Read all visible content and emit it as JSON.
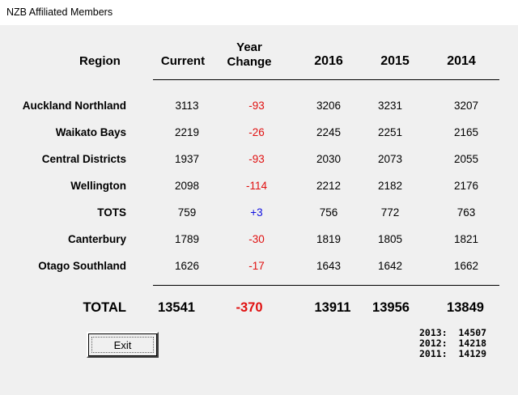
{
  "window": {
    "title": "NZB Affiliated Members"
  },
  "headers": {
    "region": "Region",
    "current": "Current",
    "year_change_line1": "Year",
    "year_change_line2": "Change",
    "y2016": "2016",
    "y2015": "2015",
    "y2014": "2014"
  },
  "rows": [
    {
      "region": "Auckland Northland",
      "current": "3113",
      "change": "-93",
      "y2016": "3206",
      "y2015": "3231",
      "y2014": "3207"
    },
    {
      "region": "Waikato Bays",
      "current": "2219",
      "change": "-26",
      "y2016": "2245",
      "y2015": "2251",
      "y2014": "2165"
    },
    {
      "region": "Central Districts",
      "current": "1937",
      "change": "-93",
      "y2016": "2030",
      "y2015": "2073",
      "y2014": "2055"
    },
    {
      "region": "Wellington",
      "current": "2098",
      "change": "-114",
      "y2016": "2212",
      "y2015": "2182",
      "y2014": "2176"
    },
    {
      "region": "TOTS",
      "current": "759",
      "change": "+3",
      "y2016": "756",
      "y2015": "772",
      "y2014": "763"
    },
    {
      "region": "Canterbury",
      "current": "1789",
      "change": "-30",
      "y2016": "1819",
      "y2015": "1805",
      "y2014": "1821"
    },
    {
      "region": "Otago Southland",
      "current": "1626",
      "change": "-17",
      "y2016": "1643",
      "y2015": "1642",
      "y2014": "1662"
    }
  ],
  "total": {
    "label": "TOTAL",
    "current": "13541",
    "change": "-370",
    "y2016": "13911",
    "y2015": "13956",
    "y2014": "13849"
  },
  "history": [
    {
      "label": "2013:",
      "value": "14507"
    },
    {
      "label": "2012:",
      "value": "14218"
    },
    {
      "label": "2011:",
      "value": "14129"
    }
  ],
  "buttons": {
    "exit_label": "Exit"
  },
  "colors": {
    "negative": "#e01010",
    "positive": "#1010e0",
    "background": "#f0f0f0"
  }
}
